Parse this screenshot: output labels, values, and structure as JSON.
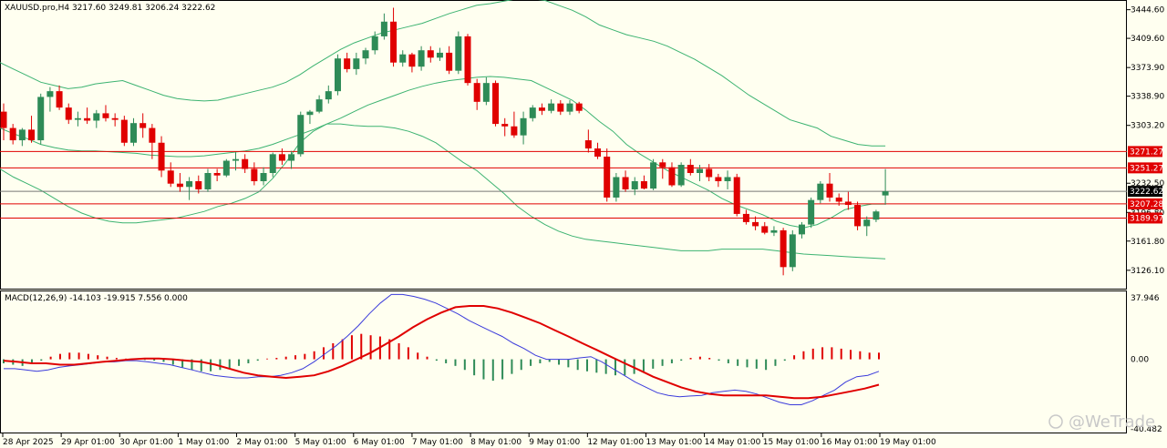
{
  "header": {
    "symbol_line": "XAUUSD.pro,H4  3217.60 3249.81 3206.24 3222.62"
  },
  "macd_header": {
    "label": "MACD(12,26,9) -14.103 -19.915 7.556 0.000"
  },
  "watermark": {
    "text": "@WeTrade"
  },
  "colors": {
    "bull": "#2e8b57",
    "bear": "#e00000",
    "band": "#3cb371",
    "level": "#e00000",
    "macd_line": "#3b3bdb",
    "signal_line": "#e00000",
    "price_tag": "#000000"
  },
  "price_axis": {
    "labels": [
      "3444.60",
      "3409.60",
      "3373.90",
      "3338.90",
      "3303.20",
      "3232.50",
      "3196.80",
      "3161.80",
      "3126.10"
    ]
  },
  "macd_axis": {
    "labels": [
      "37.946",
      "0.00",
      "-40.482"
    ]
  },
  "time_axis": {
    "labels": [
      "28 Apr 2025",
      "29 Apr 01:00",
      "30 Apr 01:00",
      "1 May 01:00",
      "2 May 01:00",
      "5 May 01:00",
      "6 May 01:00",
      "7 May 01:00",
      "8 May 01:00",
      "9 May 01:00",
      "12 May 01:00",
      "13 May 01:00",
      "14 May 01:00",
      "15 May 01:00",
      "16 May 01:00",
      "19 May 01:00"
    ]
  },
  "levels": [
    {
      "price": 3271.27,
      "label": "3271.27"
    },
    {
      "price": 3251.27,
      "label": "3251.27"
    },
    {
      "price": 3207.28,
      "label": "3207.28"
    },
    {
      "price": 3189.97,
      "label": "3189.97"
    }
  ],
  "current_price": {
    "price": 3222.62,
    "label": "3222.62"
  },
  "chart_data": [
    {
      "type": "candlestick",
      "title": "XAUUSD.pro,H4",
      "ylim": [
        3107,
        3452
      ],
      "ohlc": [
        [
          3320,
          3330,
          3285,
          3300
        ],
        [
          3300,
          3305,
          3280,
          3285
        ],
        [
          3285,
          3300,
          3278,
          3298
        ],
        [
          3298,
          3315,
          3282,
          3285
        ],
        [
          3285,
          3342,
          3280,
          3338
        ],
        [
          3338,
          3350,
          3320,
          3345
        ],
        [
          3345,
          3352,
          3322,
          3325
        ],
        [
          3325,
          3330,
          3305,
          3310
        ],
        [
          3310,
          3320,
          3302,
          3312
        ],
        [
          3312,
          3325,
          3305,
          3309
        ],
        [
          3309,
          3322,
          3300,
          3318
        ],
        [
          3318,
          3328,
          3308,
          3312
        ],
        [
          3312,
          3318,
          3302,
          3310
        ],
        [
          3310,
          3315,
          3278,
          3282
        ],
        [
          3282,
          3312,
          3278,
          3306
        ],
        [
          3306,
          3318,
          3288,
          3300
        ],
        [
          3300,
          3305,
          3262,
          3282
        ],
        [
          3282,
          3290,
          3240,
          3248
        ],
        [
          3248,
          3258,
          3228,
          3232
        ],
        [
          3232,
          3245,
          3222,
          3228
        ],
        [
          3228,
          3240,
          3212,
          3235
        ],
        [
          3235,
          3242,
          3220,
          3225
        ],
        [
          3225,
          3250,
          3222,
          3245
        ],
        [
          3245,
          3250,
          3235,
          3242
        ],
        [
          3242,
          3262,
          3240,
          3260
        ],
        [
          3260,
          3270,
          3248,
          3262
        ],
        [
          3262,
          3268,
          3245,
          3250
        ],
        [
          3250,
          3258,
          3230,
          3235
        ],
        [
          3235,
          3252,
          3230,
          3245
        ],
        [
          3245,
          3270,
          3240,
          3268
        ],
        [
          3268,
          3275,
          3255,
          3260
        ],
        [
          3260,
          3272,
          3250,
          3268
        ],
        [
          3268,
          3320,
          3265,
          3316
        ],
        [
          3316,
          3322,
          3305,
          3320
        ],
        [
          3320,
          3340,
          3318,
          3335
        ],
        [
          3335,
          3352,
          3330,
          3345
        ],
        [
          3345,
          3390,
          3340,
          3385
        ],
        [
          3385,
          3392,
          3368,
          3372
        ],
        [
          3372,
          3392,
          3365,
          3385
        ],
        [
          3385,
          3398,
          3378,
          3395
        ],
        [
          3395,
          3418,
          3390,
          3412
        ],
        [
          3412,
          3440,
          3408,
          3430
        ],
        [
          3430,
          3447,
          3375,
          3380
        ],
        [
          3380,
          3395,
          3375,
          3390
        ],
        [
          3390,
          3392,
          3368,
          3375
        ],
        [
          3375,
          3400,
          3370,
          3395
        ],
        [
          3395,
          3400,
          3380,
          3386
        ],
        [
          3386,
          3398,
          3382,
          3392
        ],
        [
          3392,
          3400,
          3366,
          3370
        ],
        [
          3370,
          3418,
          3366,
          3412
        ],
        [
          3412,
          3415,
          3352,
          3355
        ],
        [
          3355,
          3360,
          3322,
          3332
        ],
        [
          3332,
          3362,
          3328,
          3355
        ],
        [
          3355,
          3358,
          3302,
          3305
        ],
        [
          3305,
          3312,
          3290,
          3302
        ],
        [
          3302,
          3320,
          3288,
          3291
        ],
        [
          3291,
          3320,
          3280,
          3312
        ],
        [
          3312,
          3328,
          3308,
          3325
        ],
        [
          3325,
          3330,
          3316,
          3321
        ],
        [
          3321,
          3335,
          3318,
          3330
        ],
        [
          3330,
          3334,
          3316,
          3320
        ],
        [
          3320,
          3334,
          3316,
          3330
        ],
        [
          3330,
          3332,
          3318,
          3321
        ],
        [
          3285,
          3298,
          3270,
          3275
        ],
        [
          3275,
          3282,
          3262,
          3265
        ],
        [
          3265,
          3275,
          3210,
          3215
        ],
        [
          3215,
          3245,
          3210,
          3240
        ],
        [
          3240,
          3248,
          3222,
          3225
        ],
        [
          3225,
          3240,
          3218,
          3235
        ],
        [
          3235,
          3242,
          3225,
          3226
        ],
        [
          3226,
          3262,
          3224,
          3258
        ],
        [
          3258,
          3262,
          3238,
          3252
        ],
        [
          3252,
          3258,
          3228,
          3230
        ],
        [
          3230,
          3258,
          3228,
          3255
        ],
        [
          3255,
          3262,
          3242,
          3245
        ],
        [
          3245,
          3255,
          3235,
          3250
        ],
        [
          3250,
          3256,
          3235,
          3240
        ],
        [
          3240,
          3244,
          3228,
          3235
        ],
        [
          3235,
          3248,
          3225,
          3240
        ],
        [
          3240,
          3244,
          3192,
          3195
        ],
        [
          3195,
          3200,
          3182,
          3185
        ],
        [
          3185,
          3192,
          3175,
          3180
        ],
        [
          3180,
          3185,
          3170,
          3172
        ],
        [
          3172,
          3180,
          3168,
          3175
        ],
        [
          3175,
          3178,
          3120,
          3130
        ],
        [
          3130,
          3175,
          3125,
          3170
        ],
        [
          3170,
          3185,
          3165,
          3182
        ],
        [
          3182,
          3215,
          3178,
          3212
        ],
        [
          3212,
          3235,
          3208,
          3232
        ],
        [
          3232,
          3245,
          3210,
          3215
        ],
        [
          3215,
          3220,
          3205,
          3210
        ],
        [
          3210,
          3222,
          3200,
          3206
        ],
        [
          3206,
          3210,
          3175,
          3180
        ],
        [
          3180,
          3192,
          3168,
          3188
        ],
        [
          3188,
          3200,
          3185,
          3198
        ],
        [
          3217.6,
          3249.81,
          3206.24,
          3222.62
        ]
      ],
      "bands": {
        "upper": [
          3380,
          3372,
          3364,
          3356,
          3352,
          3348,
          3350,
          3354,
          3356,
          3358,
          3352,
          3346,
          3340,
          3336,
          3334,
          3333,
          3334,
          3338,
          3342,
          3346,
          3350,
          3356,
          3365,
          3376,
          3386,
          3396,
          3404,
          3410,
          3416,
          3420,
          3424,
          3428,
          3434,
          3440,
          3445,
          3450,
          3452,
          3455,
          3458,
          3458,
          3456,
          3450,
          3444,
          3436,
          3426,
          3420,
          3414,
          3410,
          3406,
          3400,
          3392,
          3384,
          3374,
          3364,
          3352,
          3340,
          3330,
          3320,
          3310,
          3305,
          3300,
          3290,
          3285,
          3280,
          3278,
          3278
        ],
        "middle": [
          3300,
          3293,
          3287,
          3280,
          3276,
          3273,
          3272,
          3272,
          3271,
          3270,
          3269,
          3267,
          3266,
          3265,
          3265,
          3266,
          3268,
          3270,
          3272,
          3275,
          3280,
          3286,
          3292,
          3298,
          3305,
          3312,
          3320,
          3328,
          3334,
          3340,
          3346,
          3351,
          3355,
          3358,
          3360,
          3362,
          3363,
          3362,
          3360,
          3358,
          3350,
          3342,
          3334,
          3322,
          3308,
          3296,
          3280,
          3268,
          3258,
          3248,
          3240,
          3232,
          3224,
          3214,
          3206,
          3200,
          3194,
          3186,
          3181,
          3178,
          3182,
          3190,
          3200,
          3204,
          3207,
          3207
        ],
        "lower": [
          3250,
          3240,
          3232,
          3224,
          3214,
          3204,
          3196,
          3190,
          3186,
          3184,
          3184,
          3186,
          3188,
          3190,
          3194,
          3198,
          3204,
          3208,
          3214,
          3222,
          3238,
          3258,
          3282,
          3296,
          3305,
          3305,
          3303,
          3302,
          3302,
          3300,
          3296,
          3290,
          3282,
          3270,
          3258,
          3248,
          3234,
          3220,
          3204,
          3192,
          3182,
          3174,
          3168,
          3164,
          3162,
          3160,
          3158,
          3156,
          3154,
          3152,
          3150,
          3150,
          3150,
          3152,
          3152,
          3152,
          3152,
          3150,
          3148,
          3146,
          3145,
          3144,
          3143,
          3142,
          3141,
          3140
        ]
      }
    },
    {
      "type": "bar+line",
      "title": "MACD(12,26,9)",
      "ylim": [
        -40.482,
        37.946
      ],
      "histogram": [
        -2.3,
        -3.1,
        -3.8,
        -2.3,
        -0.8,
        1.5,
        3.1,
        3.8,
        3.8,
        3.1,
        2.3,
        1.5,
        0.8,
        0.4,
        0,
        -0.4,
        -0.8,
        -1.5,
        -3.1,
        -4.6,
        -6.1,
        -6.9,
        -6.9,
        -6.1,
        -5.4,
        -3.8,
        -2.3,
        -0.8,
        0.4,
        0.8,
        1.5,
        2.3,
        3.1,
        4.6,
        6.9,
        9.2,
        11.5,
        13.8,
        14.6,
        13.8,
        13.1,
        11.5,
        9.2,
        6.9,
        3.8,
        1.5,
        -0.8,
        -2.3,
        -3.8,
        -6.1,
        -9.2,
        -11.5,
        -12.3,
        -11.5,
        -8.4,
        -6.1,
        -3.8,
        -2.3,
        -1.5,
        -3.1,
        -4.6,
        -6.1,
        -6.9,
        -7.7,
        -8.4,
        -9.2,
        -9.2,
        -8.4,
        -6.9,
        -5.4,
        -3.8,
        -2.3,
        -0.8,
        0.8,
        1.5,
        0.8,
        -0.8,
        -2.3,
        -3.8,
        -4.6,
        -5.4,
        -6.1,
        -3.8,
        -0.8,
        2.3,
        4.6,
        6.1,
        6.9,
        6.9,
        6.1,
        5.4,
        4.6,
        3.8,
        3.8
      ],
      "macd_line": [
        -5.4,
        -5.4,
        -6.1,
        -6.9,
        -6.1,
        -4.6,
        -3.8,
        -3.1,
        -2.3,
        -1.5,
        -1.5,
        -0.8,
        -0.8,
        -1.5,
        -2.3,
        -3.1,
        -4.6,
        -6.1,
        -7.7,
        -9.2,
        -10.0,
        -10.7,
        -10.7,
        -10.0,
        -10.0,
        -9.2,
        -7.7,
        -5.4,
        -1.5,
        3.1,
        7.7,
        13.1,
        19.2,
        26.1,
        32.3,
        37.2,
        37.2,
        36.1,
        34.5,
        32.3,
        29.2,
        26.1,
        22.3,
        19.2,
        16.1,
        13.1,
        9.2,
        6.1,
        2.3,
        0,
        0,
        0,
        0.8,
        1.5,
        -1.5,
        -5.4,
        -9.2,
        -13.1,
        -16.1,
        -19.2,
        -20.7,
        -21.5,
        -21.1,
        -20.7,
        -19.2,
        -18.4,
        -17.7,
        -18.4,
        -20.0,
        -22.3,
        -24.6,
        -26.1,
        -26.1,
        -23.8,
        -20.7,
        -17.7,
        -13.1,
        -10.0,
        -9.2,
        -6.9
      ],
      "signal_line": [
        -0.8,
        -1.5,
        -2.3,
        -2.3,
        -3.1,
        -3.1,
        -2.3,
        -1.5,
        -0.8,
        0,
        0.4,
        0.4,
        0,
        -0.8,
        -1.5,
        -3.1,
        -5.4,
        -7.7,
        -9.2,
        -10.0,
        -10.7,
        -10.0,
        -9.2,
        -6.9,
        -3.8,
        0,
        3.8,
        8.4,
        13.1,
        18.4,
        23.0,
        26.8,
        29.9,
        30.6,
        30.6,
        29.2,
        26.8,
        23.8,
        20.7,
        16.8,
        13.1,
        9.2,
        5.4,
        1.5,
        -2.3,
        -6.1,
        -10.0,
        -13.1,
        -16.1,
        -18.4,
        -19.9,
        -20.7,
        -20.7,
        -20.7,
        -20.7,
        -21.5,
        -22.3,
        -22.3,
        -21.5,
        -20.0,
        -18.4,
        -16.8,
        -14.6
      ]
    }
  ]
}
